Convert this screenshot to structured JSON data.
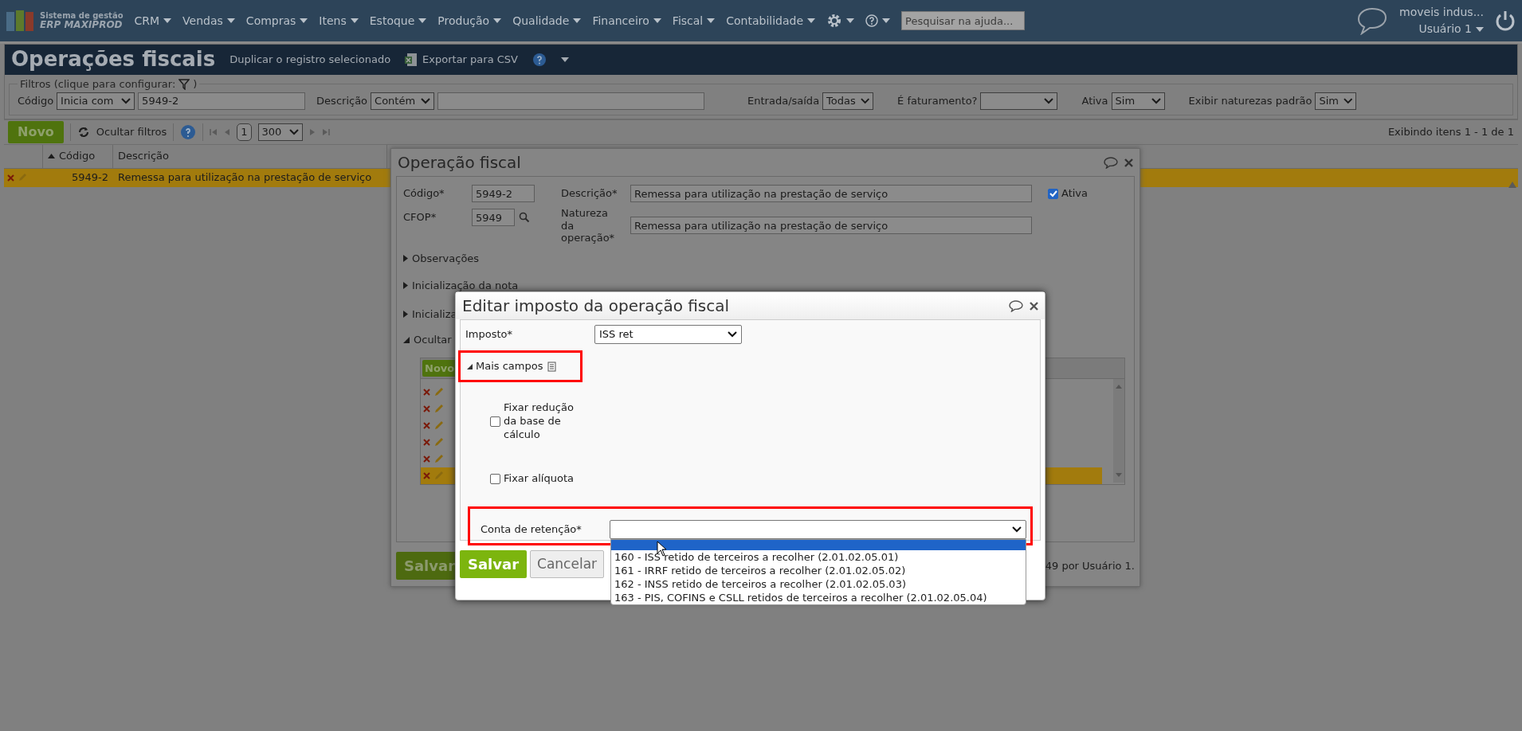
{
  "top_nav": {
    "logo_line1": "Sistema de gestão",
    "logo_line2": "ERP MAXIPROD",
    "menu": [
      {
        "label": "CRM"
      },
      {
        "label": "Vendas"
      },
      {
        "label": "Compras"
      },
      {
        "label": "Itens"
      },
      {
        "label": "Estoque"
      },
      {
        "label": "Produção"
      },
      {
        "label": "Qualidade"
      },
      {
        "label": "Financeiro"
      },
      {
        "label": "Fiscal"
      },
      {
        "label": "Contabilidade"
      }
    ],
    "search": {
      "placeholder": "Pesquisar na ajuda..."
    },
    "company": "moveis indus...",
    "user": "Usuário 1"
  },
  "title_bar": {
    "title": "Operações fiscais",
    "duplicate": "Duplicar o registro selecionado",
    "export": "Exportar para CSV"
  },
  "filters": {
    "legend": "Filtros (clique para configurar:",
    "legend_end": ")",
    "fields": [
      {
        "kind": "text",
        "label": "Código",
        "operator": "Inicia com",
        "value": "5949-2"
      },
      {
        "kind": "text",
        "label": "Descrição",
        "operator": "Contém"
      },
      {
        "kind": "select",
        "label": "Entrada/saída",
        "value": "Todas"
      },
      {
        "kind": "select",
        "label": "É faturamento?"
      },
      {
        "kind": "select",
        "label": "Ativa",
        "value": "Sim"
      },
      {
        "kind": "select",
        "label": "Exibir naturezas padrão",
        "value": "Sim"
      }
    ]
  },
  "toolbar": {
    "new": "Novo",
    "hide_filters": "Ocultar filtros",
    "page": "1",
    "page_size": "300",
    "summary": "Exibindo itens 1 - 1 de 1"
  },
  "table": {
    "columns": [
      {
        "label": "Código",
        "sorted": true
      },
      {
        "label": "Descrição",
        "sorted": false
      }
    ],
    "rows": [
      {
        "cells": [
          "5949-2",
          "Remessa para utilização na prestação de serviço"
        ],
        "selected": true
      }
    ]
  },
  "fiscal_dialog": {
    "title": "Operação fiscal",
    "code_label": "Código*",
    "code": "5949-2",
    "cfop_label": "CFOP*",
    "cfop": "5949",
    "description_label": "Descrição*",
    "description": "Remessa para utilização na prestação de serviço",
    "nature_label": "Natureza da operação*",
    "nature": "Remessa para utilização na prestação de serviço",
    "active": {
      "label": "Ativa",
      "checked": true
    },
    "sections": [
      {
        "label": "Observações",
        "expanded": false
      },
      {
        "label": "Inicialização da nota",
        "expanded": false
      },
      {
        "label": "Inicializa",
        "expanded": false
      },
      {
        "label": "Ocultar",
        "expanded": true
      }
    ],
    "grid": {
      "new": "Novo",
      "rows": [
        {
          "selected": false
        },
        {
          "selected": false
        },
        {
          "selected": false
        },
        {
          "selected": false
        },
        {
          "selected": false
        },
        {
          "selected": true
        }
      ]
    },
    "save": "Salvar",
    "footer_note": "49 por Usuário 1."
  },
  "tax_dialog": {
    "title": "Editar imposto da operação fiscal",
    "tax_label": "Imposto*",
    "tax_value": "ISS ret",
    "more_fields": {
      "label": "Mais campos",
      "expanded": true,
      "highlighted": true
    },
    "checkboxes": [
      {
        "label": "Fixar redução da base de cálculo",
        "checked": false
      },
      {
        "label": "Fixar alíquota",
        "checked": false
      }
    ],
    "account": {
      "label": "Conta de retenção*",
      "highlighted": true
    },
    "account_options": [
      {
        "selected": true
      },
      {
        "label": "160 - ISS retido de terceiros a recolher (2.01.02.05.01)",
        "selected": false
      },
      {
        "label": "161 - IRRF retido de terceiros a recolher (2.01.02.05.02)",
        "selected": false
      },
      {
        "label": "162 - INSS retido de terceiros a recolher (2.01.02.05.03)",
        "selected": false
      },
      {
        "label": "163 - PIS, COFINS e CSLL retidos de terceiros a recolher (2.01.02.05.04)",
        "selected": false
      }
    ],
    "save": "Salvar",
    "cancel": "Cancelar"
  }
}
